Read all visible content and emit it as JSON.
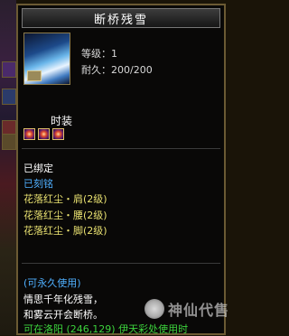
{
  "item": {
    "name": "断桥残雪",
    "level": "等级：1",
    "durability": "耐久：200/200",
    "type": "时装",
    "gem_count": 3
  },
  "attributes": [
    "已绑定",
    "已刻铭",
    "花落红尘・肩(2级)",
    "花落红尘・腰(2级)",
    "花落红尘・脚(2级)"
  ],
  "description": {
    "usage": "(可永久使用)",
    "line1": "情思千年化残雪，",
    "line2": "和雾云开会断桥。",
    "location": "可在洛阳 (246,129) 伊天彩处使用时"
  },
  "watermark": {
    "text": "神仙代售"
  },
  "colors": {
    "title": "#ffffff",
    "bound": "#ffffff",
    "engraved": "#4fb0ff",
    "set_bonus": "#e8e070",
    "usage": "#4fb0ff",
    "location": "#3cd23c",
    "border": "#6b5a33"
  }
}
